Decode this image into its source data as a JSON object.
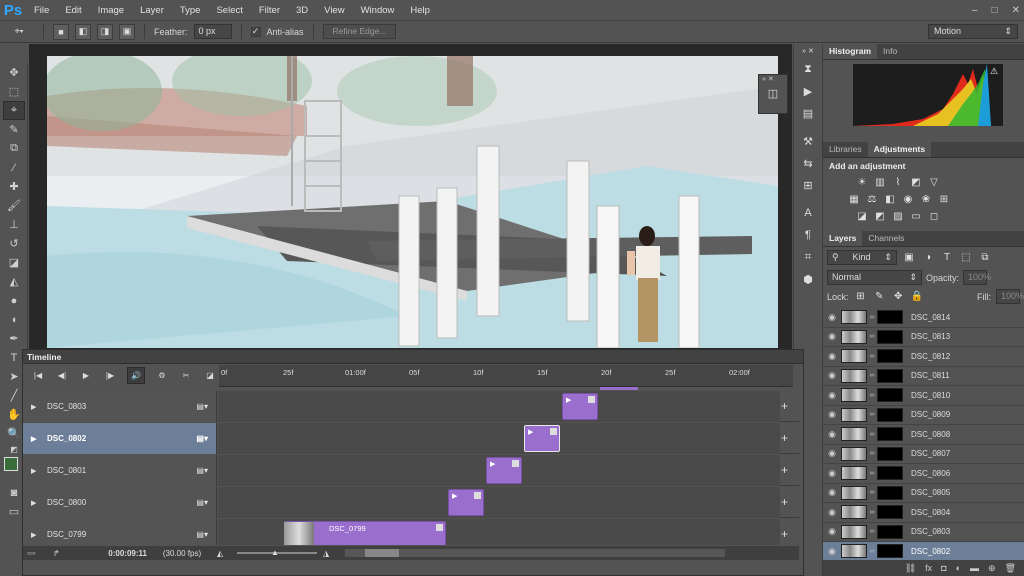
{
  "app": {
    "logo": "Ps"
  },
  "menu": [
    "File",
    "Edit",
    "Image",
    "Layer",
    "Type",
    "Select",
    "Filter",
    "3D",
    "View",
    "Window",
    "Help"
  ],
  "window_controls": [
    "–",
    "□",
    "✕"
  ],
  "options": {
    "feather_label": "Feather:",
    "feather_value": "0 px",
    "antialias_label": "Anti-alias",
    "refine_edge": "Refine Edge...",
    "workspace": "Motion"
  },
  "panels": {
    "histogram_tabs": [
      "Histogram",
      "Info"
    ],
    "adjust_tabs": [
      "Libraries",
      "Adjustments"
    ],
    "add_adjustment": "Add an adjustment",
    "layers_tabs": [
      "Layers",
      "Channels"
    ],
    "filter_kind": "Kind",
    "blend_mode": "Normal",
    "opacity_label": "Opacity:",
    "opacity_value": "100%",
    "lock_label": "Lock:",
    "fill_label": "Fill:",
    "fill_value": "100%"
  },
  "layers": [
    {
      "name": "DSC_0814",
      "selected": false
    },
    {
      "name": "DSC_0813",
      "selected": false
    },
    {
      "name": "DSC_0812",
      "selected": false
    },
    {
      "name": "DSC_0811",
      "selected": false
    },
    {
      "name": "DSC_0810",
      "selected": false
    },
    {
      "name": "DSC_0809",
      "selected": false
    },
    {
      "name": "DSC_0808",
      "selected": false
    },
    {
      "name": "DSC_0807",
      "selected": false
    },
    {
      "name": "DSC_0806",
      "selected": false
    },
    {
      "name": "DSC_0805",
      "selected": false
    },
    {
      "name": "DSC_0804",
      "selected": false
    },
    {
      "name": "DSC_0803",
      "selected": false
    },
    {
      "name": "DSC_0802",
      "selected": true
    }
  ],
  "timeline": {
    "title": "Timeline",
    "ruler": [
      "0f",
      "25f",
      "01:00f",
      "05f",
      "10f",
      "15f",
      "20f",
      "25f",
      "02:00f"
    ],
    "tracks": [
      {
        "name": "DSC_0803",
        "selected": false
      },
      {
        "name": "DSC_0802",
        "selected": true
      },
      {
        "name": "DSC_0801",
        "selected": false
      },
      {
        "name": "DSC_0800",
        "selected": false
      },
      {
        "name": "DSC_0799",
        "selected": false
      }
    ],
    "clip_label_0799": "DSC_0799",
    "timecode": "0:00:09:11",
    "fps": "(30.00 fps)"
  }
}
